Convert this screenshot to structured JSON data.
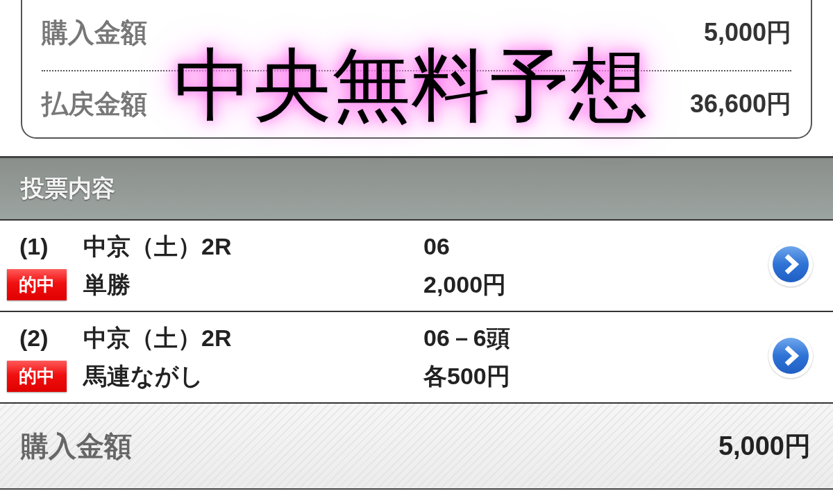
{
  "summary": {
    "rows": [
      {
        "label": "購入金額",
        "value": "5,000円"
      },
      {
        "label": "払戻金額",
        "value": "36,600円"
      }
    ]
  },
  "overlay_caption": "中央無料予想",
  "section": {
    "title": "投票内容"
  },
  "bets": [
    {
      "number": "(1)",
      "race": "中京（土）2R",
      "badge": "的中",
      "bet_type": "単勝",
      "selection": "06",
      "amount": "2,000円"
    },
    {
      "number": "(2)",
      "race": "中京（土）2R",
      "badge": "的中",
      "bet_type": "馬連ながし",
      "selection": "06－6頭",
      "amount": "各500円"
    }
  ],
  "footer": {
    "label": "購入金額",
    "value": "5,000円"
  }
}
